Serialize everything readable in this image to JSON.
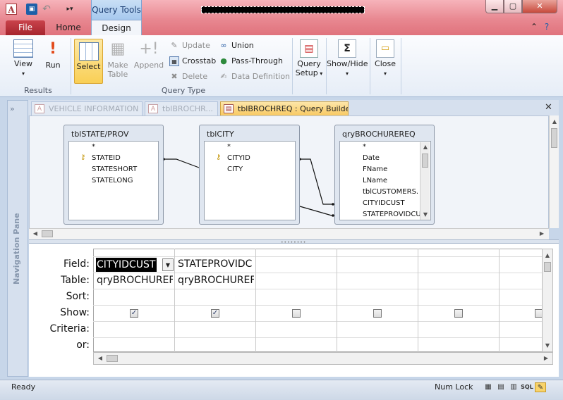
{
  "titlebar": {
    "app_icon": "A",
    "context_tab": "Query Tools",
    "window_title_redacted": ""
  },
  "ribbon_tabs": {
    "file": "File",
    "home": "Home",
    "design": "Design"
  },
  "ribbon": {
    "results": {
      "label": "Results",
      "view": "View",
      "run": "Run"
    },
    "query_type": {
      "label": "Query Type",
      "select": "Select",
      "make_table_1": "Make",
      "make_table_2": "Table",
      "append": "Append",
      "update": "Update",
      "crosstab": "Crosstab",
      "delete": "Delete",
      "union": "Union",
      "pass_through": "Pass-Through",
      "data_definition": "Data Definition"
    },
    "query_setup_1": "Query",
    "query_setup_2": "Setup",
    "show_hide_1": "Show/Hide",
    "close_1": "Close",
    "sigma_glyph": "Σ"
  },
  "navigation_pane": {
    "label": "Navigation Pane",
    "expand": "»"
  },
  "doc_tabs": [
    {
      "label": "VEHICLE INFORMATION"
    },
    {
      "label": "tblBROCHR..."
    },
    {
      "label": "tblBROCHREQ : Query Builder"
    }
  ],
  "tables": [
    {
      "title": "tblSTATE/PROV",
      "fields": [
        "*",
        "STATEID",
        "STATESHORT",
        "STATELONG"
      ],
      "key_index": 1
    },
    {
      "title": "tblCITY",
      "fields": [
        "*",
        "CITYID",
        "CITY"
      ],
      "key_index": 1
    },
    {
      "title": "qryBROCHUREREQ",
      "fields": [
        "*",
        "Date",
        "FName",
        "LName",
        "tblCUSTOMERS.",
        "CITYIDCUST",
        "STATEPROVIDCU"
      ],
      "key_index": -1
    }
  ],
  "grid": {
    "row_labels": {
      "field": "Field:",
      "table": "Table:",
      "sort": "Sort:",
      "show": "Show:",
      "criteria": "Criteria:",
      "or": "or:"
    },
    "columns": [
      {
        "field": "CITYIDCUST",
        "table": "qryBROCHUREF",
        "show": true
      },
      {
        "field": "STATEPROVIDC",
        "table": "qryBROCHUREF",
        "show": true
      },
      {
        "field": "",
        "table": "",
        "show": false
      },
      {
        "field": "",
        "table": "",
        "show": false
      },
      {
        "field": "",
        "table": "",
        "show": false
      },
      {
        "field": "",
        "table": "",
        "show": false
      }
    ],
    "checkmark": "✓"
  },
  "status": {
    "ready": "Ready",
    "num_lock": "Num Lock",
    "sql": "SQL"
  }
}
